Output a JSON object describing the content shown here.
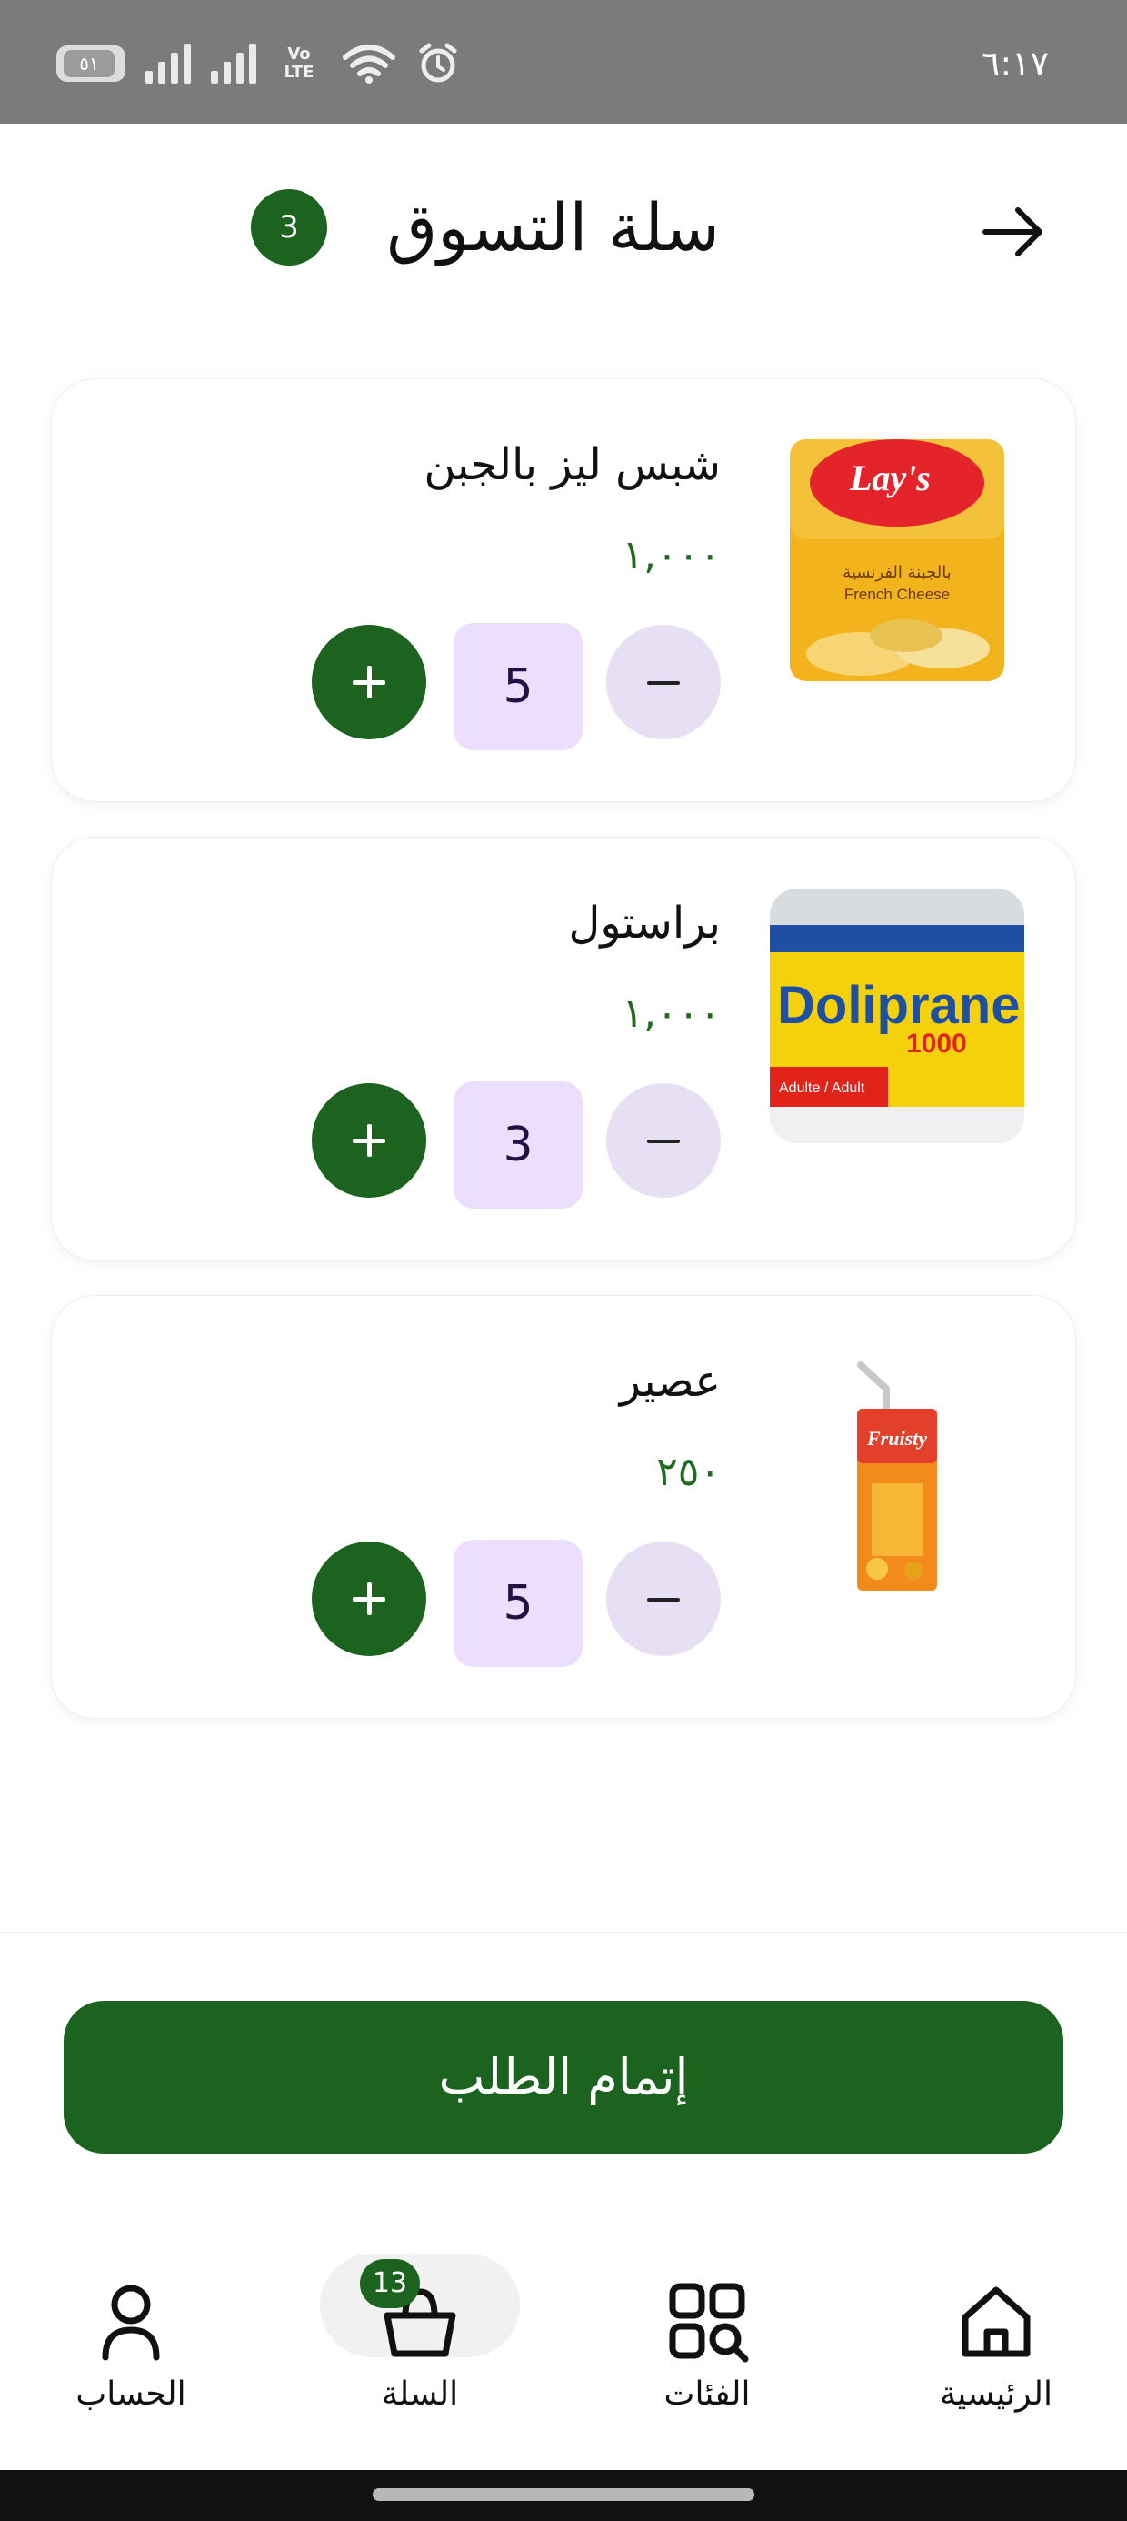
{
  "status_bar": {
    "time": "٦:١٧",
    "battery_level": "٥١",
    "volte_label": "Vo LTE"
  },
  "header": {
    "title": "سلة التسوق",
    "badge_count": "3",
    "back_icon": "arrow-right-icon"
  },
  "cart": {
    "items": [
      {
        "name": "شبس ليز بالجبن",
        "price": "١,٠٠٠",
        "quantity": "5",
        "image": "lays-french-cheese-chips"
      },
      {
        "name": "براستول",
        "price": "١,٠٠٠",
        "quantity": "3",
        "image": "doliprane-1000mg-box"
      },
      {
        "name": "عصير",
        "price": "٢٥٠",
        "quantity": "5",
        "image": "fruisty-mango-juice-box"
      }
    ]
  },
  "checkout": {
    "label": "إتمام الطلب"
  },
  "bottom_nav": {
    "items": [
      {
        "label": "الرئيسية",
        "icon": "home-icon"
      },
      {
        "label": "الفئات",
        "icon": "categories-icon"
      },
      {
        "label": "السلة",
        "icon": "basket-icon",
        "badge": "13"
      },
      {
        "label": "الحساب",
        "icon": "user-icon"
      }
    ]
  },
  "colors": {
    "primary": "#1c631f",
    "qty_value_bg": "#ebdffd",
    "qty_minus_bg": "#e7dff3",
    "price_text": "#1f6b22"
  }
}
